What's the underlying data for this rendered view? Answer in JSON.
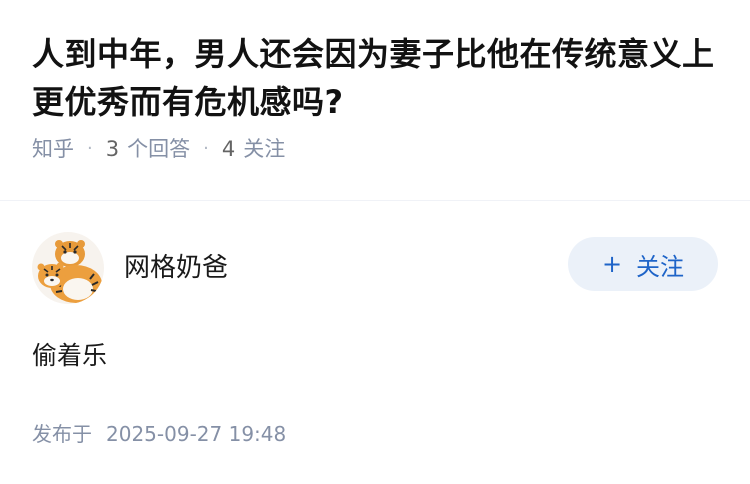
{
  "question": {
    "title": "人到中年，男人还会因为妻子比他在传统意义上更优秀而有危机感吗?",
    "source": "知乎",
    "answer_count": "3",
    "answer_label": "个回答",
    "follower_count": "4",
    "follower_label": "关注"
  },
  "answer": {
    "author_name": "网格奶爸",
    "follow_icon": "plus-icon",
    "follow_label": "关注",
    "content": "偷着乐",
    "published_prefix": "发布于",
    "published_date": "2025-09-27 19:48"
  },
  "colors": {
    "meta": "#8590a6",
    "follow_button_bg": "#ebf1f9",
    "follow_button_text": "#1e64c8"
  }
}
